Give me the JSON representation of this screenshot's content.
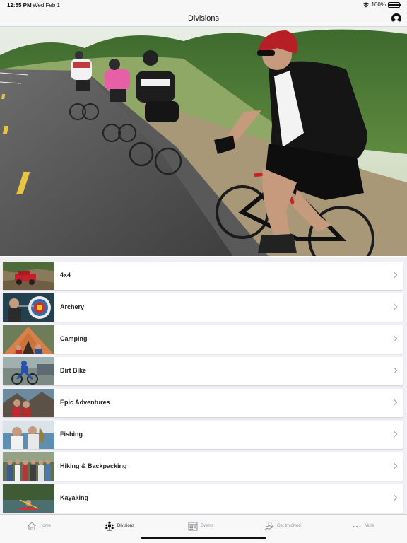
{
  "status_bar": {
    "time": "12:55 PM",
    "date": "Wed Feb 1",
    "battery": "100%"
  },
  "nav": {
    "title": "Divisions"
  },
  "divisions": [
    {
      "label": "4x4"
    },
    {
      "label": "Archery"
    },
    {
      "label": "Camping"
    },
    {
      "label": "Dirt Bike"
    },
    {
      "label": "Epic Adventures"
    },
    {
      "label": "Fishing"
    },
    {
      "label": "Hiking & Backpacking"
    },
    {
      "label": "Kayaking"
    }
  ],
  "tabs": [
    {
      "label": "Home",
      "icon": "home-icon"
    },
    {
      "label": "Divisions",
      "icon": "divisions-icon",
      "active": true
    },
    {
      "label": "Events",
      "icon": "calendar-icon"
    },
    {
      "label": "Get Involved",
      "icon": "hands-icon"
    },
    {
      "label": "More",
      "icon": "more-dots-icon"
    }
  ]
}
